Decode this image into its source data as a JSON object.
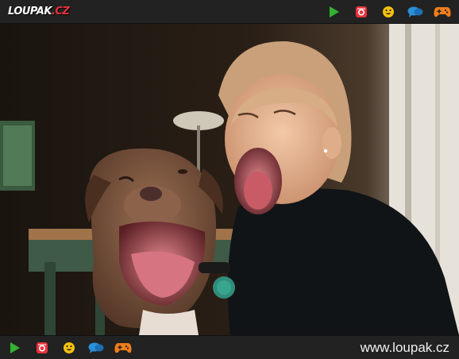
{
  "header": {
    "logo_text": "LOUPAK",
    "logo_suffix": ".CZ"
  },
  "nav_icons": [
    {
      "name": "play-icon",
      "color": "#34b233"
    },
    {
      "name": "instagram-icon",
      "color": "#e8323c"
    },
    {
      "name": "smiley-icon",
      "color": "#f4c20d"
    },
    {
      "name": "chat-bubbles-icon",
      "color": "#2a8fd8"
    },
    {
      "name": "gamepad-icon",
      "color": "#f07d1a"
    }
  ],
  "footer": {
    "url_text": "www.loupak.cz"
  },
  "photo": {
    "subject": "dog-and-woman-yawning-photo"
  },
  "colors": {
    "bar_background": "#222222",
    "logo_accent": "#e8323c"
  }
}
